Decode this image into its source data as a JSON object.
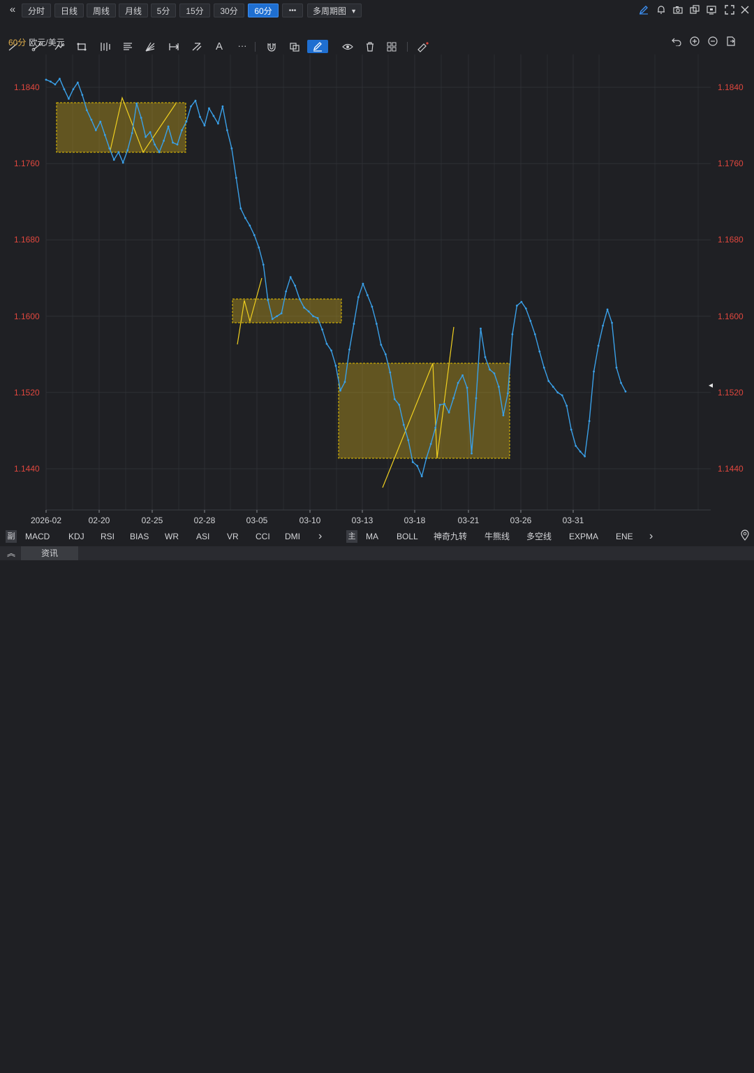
{
  "toolbar": {
    "back_icon": "double-chevron-left-icon",
    "periods": [
      "分时",
      "日线",
      "周线",
      "月线",
      "5分",
      "15分",
      "30分",
      "60分"
    ],
    "active_period": "60分",
    "more_label": "•••",
    "multi_period_label": "多周期图",
    "right_icons": [
      "pencil-icon",
      "bell-icon",
      "camera-icon",
      "copy-icon",
      "window-icon",
      "fullscreen-icon"
    ]
  },
  "drawing_tools": [
    "line-icon",
    "ray-icon",
    "polyline-icon",
    "rect-icon",
    "parallel-icon",
    "fib-icon",
    "fan-icon",
    "measure-icon",
    "pitchfork-icon",
    "text-icon",
    "more-icon",
    "magnet-icon",
    "layer-icon",
    "pen-icon",
    "eye-icon",
    "trash-icon",
    "grid-icon",
    "ruler-icon"
  ],
  "symbol": {
    "period": "60分",
    "name": "欧元/美元"
  },
  "chart_tools": [
    "undo-icon",
    "zoom-in-icon",
    "zoom-out-icon",
    "export-icon"
  ],
  "chart_data": {
    "type": "line",
    "ylim": [
      1.1415,
      1.186
    ],
    "y_ticks": [
      "1.1840",
      "1.1760",
      "1.1680",
      "1.1600",
      "1.1520",
      "1.1440"
    ],
    "x_ticks": [
      "2026-02",
      "02-20",
      "02-25",
      "02-28",
      "03-05",
      "03-10",
      "03-13",
      "03-18",
      "03-21",
      "03-26",
      "03-31"
    ],
    "n_points": 112,
    "series": [
      {
        "color": "#3aa0e8",
        "values": [
          1.1848,
          1.1846,
          1.1843,
          1.1849,
          1.1838,
          1.1828,
          1.1838,
          1.1845,
          1.1832,
          1.1816,
          1.1806,
          1.1795,
          1.1804,
          1.179,
          1.1776,
          1.1764,
          1.1772,
          1.1761,
          1.1774,
          1.1792,
          1.1823,
          1.1808,
          1.1788,
          1.1793,
          1.178,
          1.1772,
          1.1784,
          1.1799,
          1.1782,
          1.178,
          1.1795,
          1.1804,
          1.182,
          1.1826,
          1.1809,
          1.18,
          1.1818,
          1.181,
          1.1802,
          1.182,
          1.1795,
          1.1776,
          1.1745,
          1.1713,
          1.1703,
          1.1695,
          1.1685,
          1.1672,
          1.1654,
          1.1617,
          1.1597,
          1.16,
          1.1603,
          1.1626,
          1.1641,
          1.1632,
          1.1618,
          1.1609,
          1.1605,
          1.16,
          1.1598,
          1.1586,
          1.1571,
          1.1564,
          1.1548,
          1.1522,
          1.1531,
          1.1565,
          1.1592,
          1.162,
          1.1634,
          1.1622,
          1.161,
          1.1592,
          1.157,
          1.156,
          1.1541,
          1.1513,
          1.1507,
          1.1486,
          1.147,
          1.1447,
          1.1443,
          1.1432,
          1.1451,
          1.1466,
          1.1483,
          1.1507,
          1.1508,
          1.1499,
          1.1514,
          1.153,
          1.1538,
          1.1525,
          1.1456,
          1.1514,
          1.1587,
          1.1557,
          1.1544,
          1.154,
          1.1526,
          1.1496,
          1.1519,
          1.1581,
          1.1611,
          1.1615,
          1.1608,
          1.1595,
          1.1581,
          1.1563,
          1.1546,
          1.1532,
          1.1526,
          1.152,
          1.1517,
          1.1506,
          1.1481,
          1.1464,
          1.1458,
          1.1453,
          1.149,
          1.1542,
          1.1569,
          1.159,
          1.1607,
          1.1593,
          1.1546,
          1.153,
          1.1521
        ]
      }
    ]
  },
  "current_price_marker": "◂",
  "indicators_left": {
    "tag": "副",
    "items": [
      "MACD",
      "KDJ",
      "RSI",
      "BIAS",
      "WR",
      "ASI",
      "VR",
      "CCI",
      "DMI"
    ],
    "next": "›"
  },
  "indicators_right": {
    "tag": "主",
    "items": [
      "MA",
      "BOLL",
      "神奇九转",
      "牛熊线",
      "多空线",
      "EXPMA",
      "ENE"
    ],
    "next": "›"
  },
  "footer": {
    "expand_icon": "double-chevron-up-icon",
    "tab": "资讯"
  },
  "location_icon": "location-pin-icon"
}
